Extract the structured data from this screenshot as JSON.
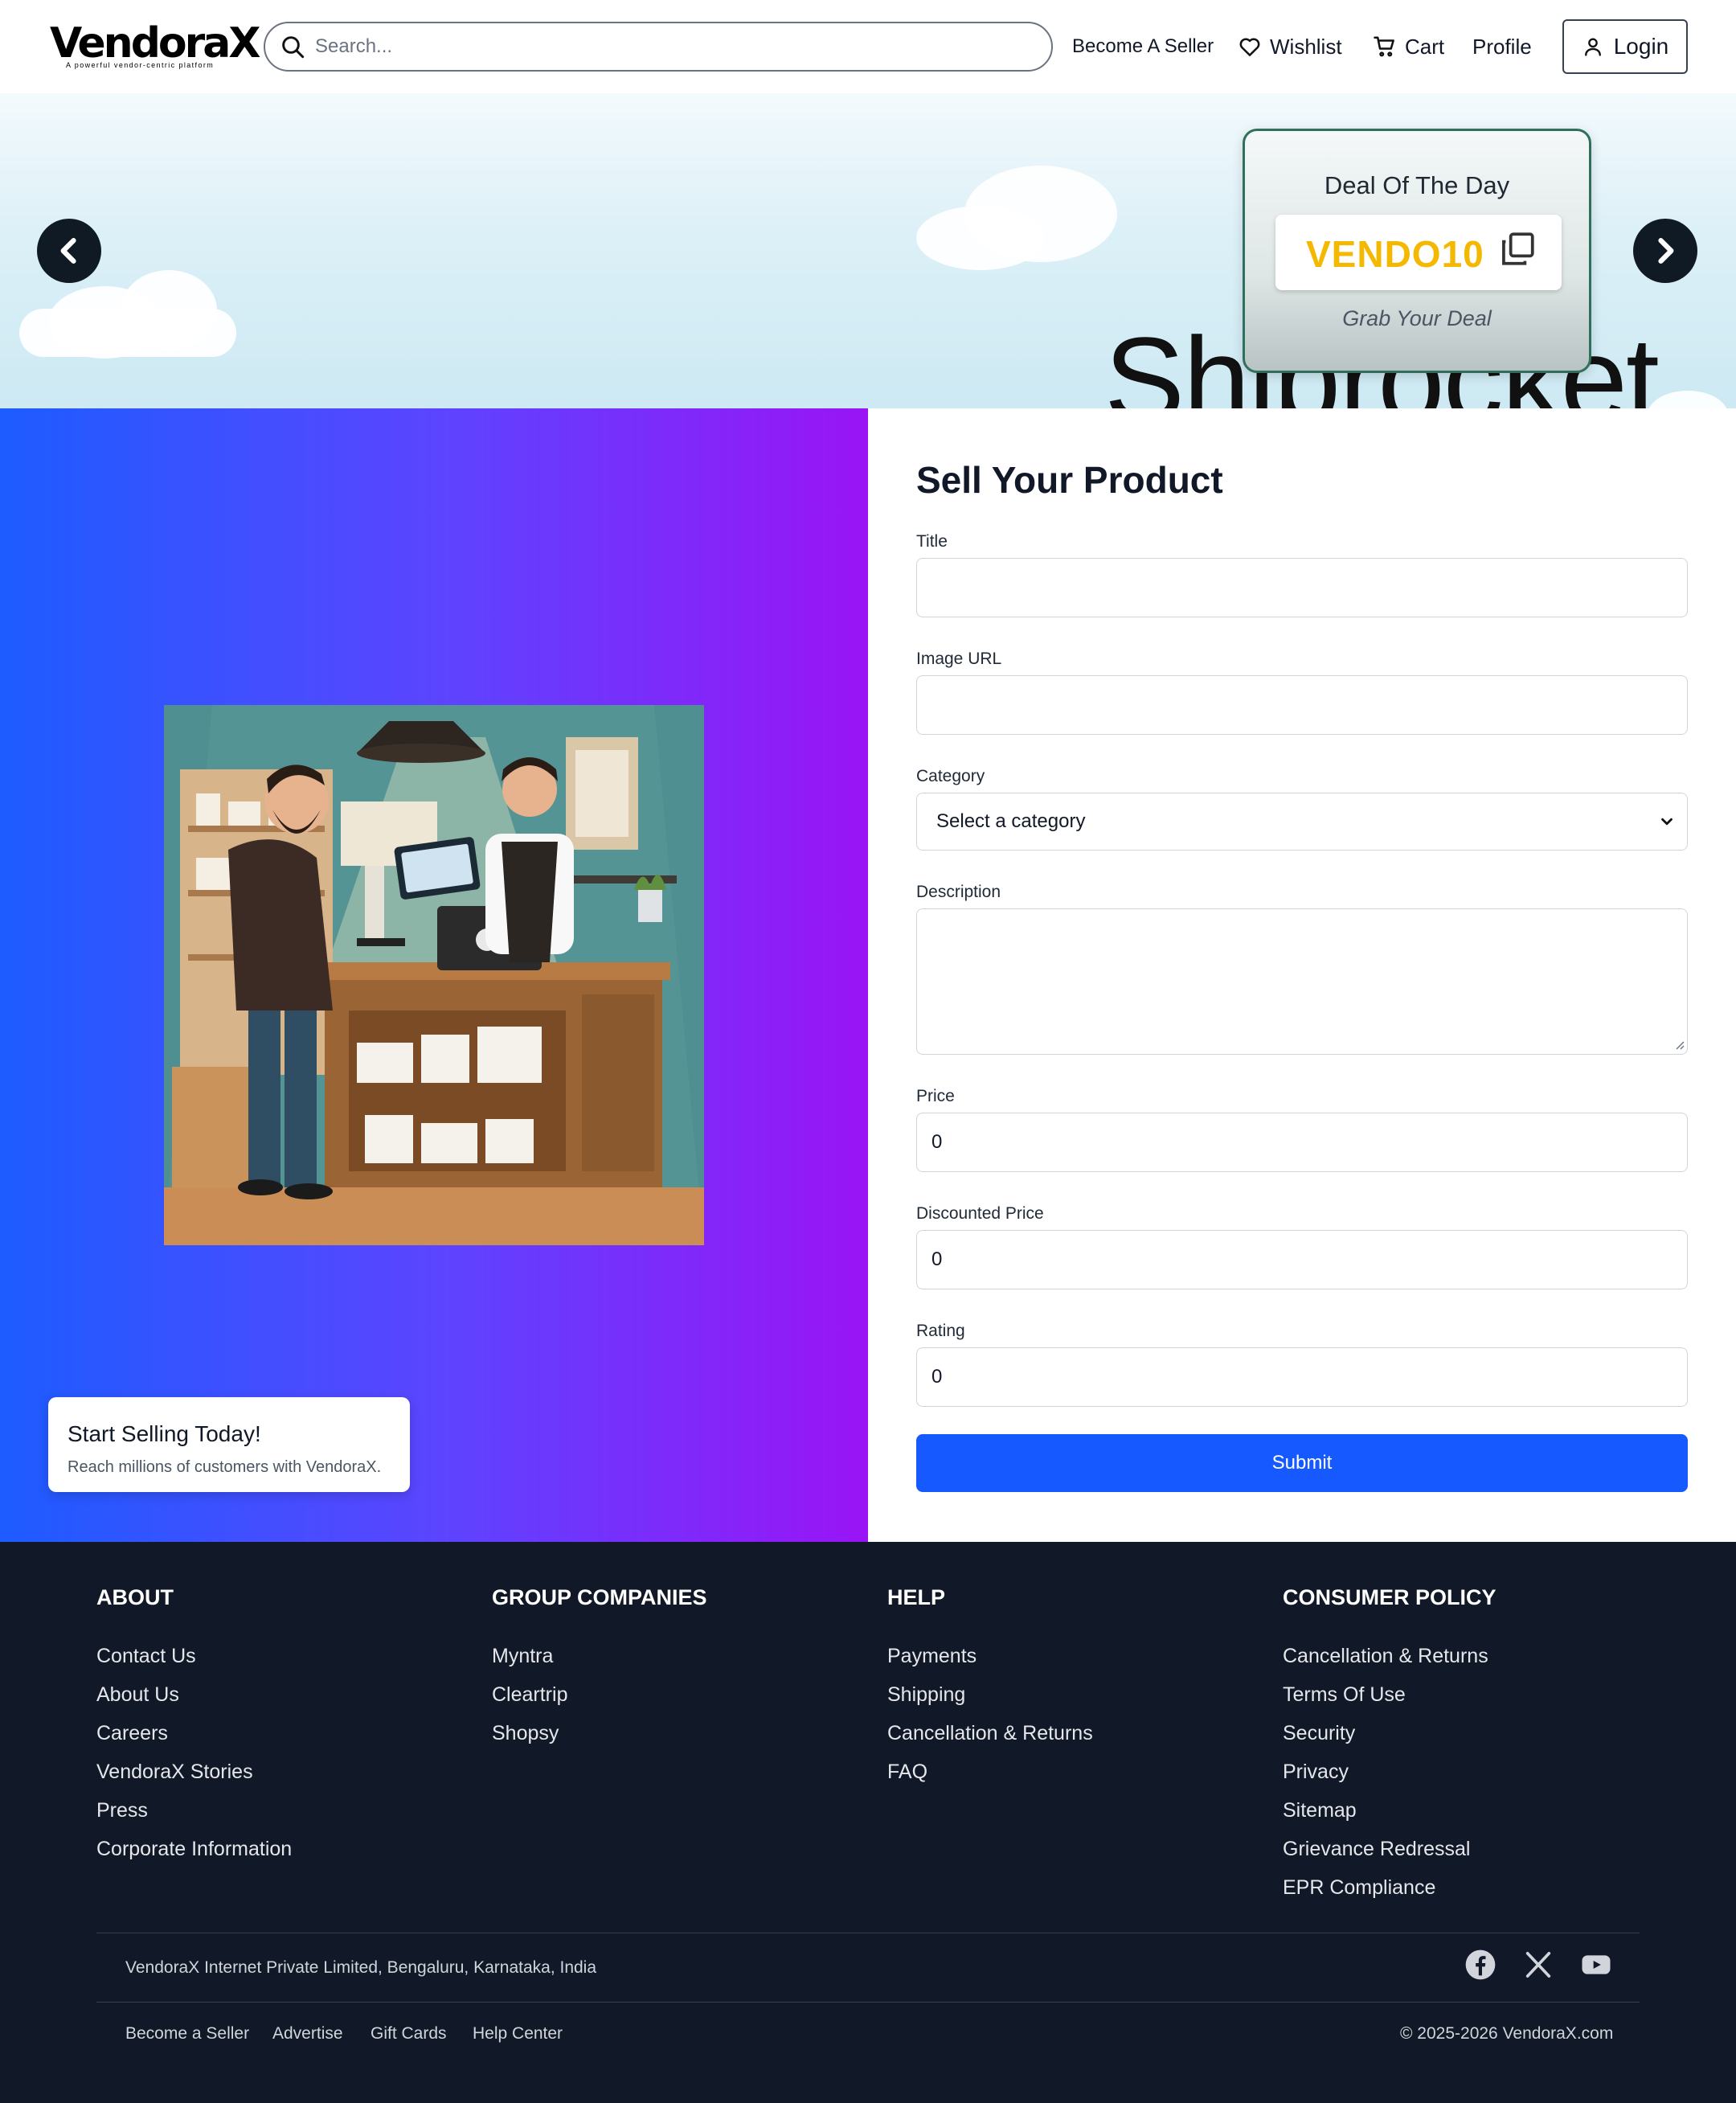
{
  "header": {
    "logo_word": "VendoraX",
    "logo_tagline": "A powerful vendor-centric platform",
    "search_placeholder": "Search...",
    "nav": {
      "become_seller": "Become A Seller",
      "wishlist": "Wishlist",
      "cart": "Cart",
      "profile": "Profile",
      "login": "Login"
    }
  },
  "banner": {
    "background_text": "Shiprocket",
    "deal": {
      "title": "Deal Of The Day",
      "code": "VENDO10",
      "subtitle": "Grab Your Deal"
    }
  },
  "promo": {
    "title": "Start Selling Today!",
    "subtitle": "Reach millions of customers with VendoraX."
  },
  "form": {
    "title": "Sell Your Product",
    "fields": {
      "title_label": "Title",
      "title_value": "",
      "image_url_label": "Image URL",
      "image_url_value": "",
      "category_label": "Category",
      "category_selected": "Select a category",
      "description_label": "Description",
      "description_value": "",
      "price_label": "Price",
      "price_value": "0",
      "discounted_price_label": "Discounted Price",
      "discounted_price_value": "0",
      "rating_label": "Rating",
      "rating_value": "0"
    },
    "submit_label": "Submit",
    "accent_color": "#1559ff"
  },
  "footer": {
    "columns": [
      {
        "heading": "ABOUT",
        "links": [
          "Contact Us",
          "About Us",
          "Careers",
          "VendoraX Stories",
          "Press",
          "Corporate Information"
        ]
      },
      {
        "heading": "GROUP COMPANIES",
        "links": [
          "Myntra",
          "Cleartrip",
          "Shopsy"
        ]
      },
      {
        "heading": "HELP",
        "links": [
          "Payments",
          "Shipping",
          "Cancellation & Returns",
          "FAQ"
        ]
      },
      {
        "heading": "CONSUMER POLICY",
        "links": [
          "Cancellation & Returns",
          "Terms Of Use",
          "Security",
          "Privacy",
          "Sitemap",
          "Grievance Redressal",
          "EPR Compliance"
        ]
      }
    ],
    "address": "VendoraX Internet Private Limited, Bengaluru, Karnataka, India",
    "social_icons": [
      "facebook-icon",
      "x-icon",
      "youtube-icon"
    ],
    "bottom_links": [
      "Become a Seller",
      "Advertise",
      "Gift Cards",
      "Help Center"
    ],
    "copyright": "© 2025-2026 VendoraX.com"
  }
}
